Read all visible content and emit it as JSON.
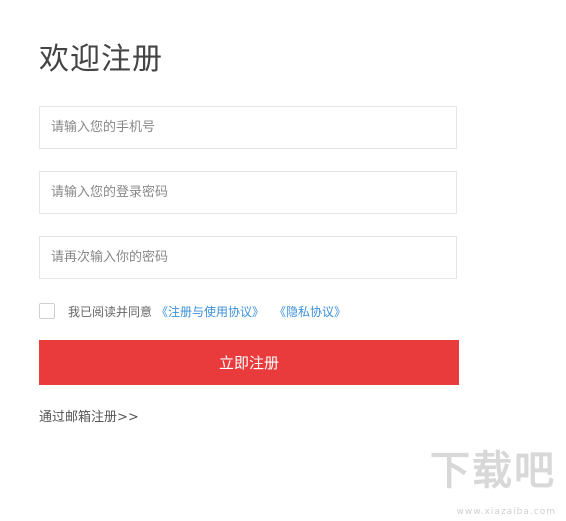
{
  "page_title": "欢迎注册",
  "form": {
    "phone_placeholder": "请输入您的手机号",
    "password_placeholder": "请输入您的登录密码",
    "confirm_placeholder": "请再次输入你的密码"
  },
  "agreement": {
    "text": "我已阅读并同意",
    "terms_link": "《注册与使用协议》",
    "privacy_link": "《隐私协议》",
    "checked": false
  },
  "submit_label": "立即注册",
  "email_register_link": "通过邮箱注册>>",
  "watermark": {
    "logo_text": "下载吧",
    "site_text": "www.xiazaiba.com"
  },
  "colors": {
    "primary_button": "#e93b3b",
    "link": "#3a8fd9"
  }
}
